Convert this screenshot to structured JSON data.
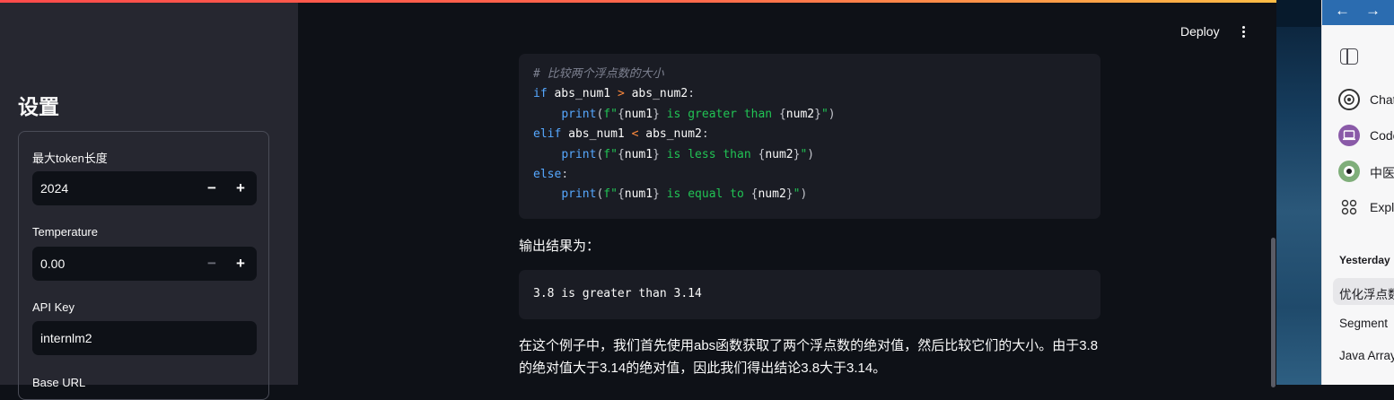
{
  "sidebar": {
    "title": "设置",
    "max_token": {
      "label": "最大token长度",
      "value": "2024",
      "minus": "−",
      "plus": "+"
    },
    "temperature": {
      "label": "Temperature",
      "value": "0.00",
      "minus": "−",
      "plus": "+"
    },
    "api_key": {
      "label": "API Key",
      "value": "internlm2"
    },
    "base_url": {
      "label": "Base URL"
    }
  },
  "header": {
    "deploy_label": "Deploy"
  },
  "chat": {
    "code_lines": [
      "# 比较两个浮点数的大小",
      "if abs_num1 > abs_num2:",
      "    print(f\"{num1} is greater than {num2}\")",
      "elif abs_num1 < abs_num2:",
      "    print(f\"{num1} is less than {num2}\")",
      "else:",
      "    print(f\"{num1} is equal to {num2}\")"
    ],
    "output_intro": "输出结果为：",
    "output_code": "3.8 is greater than 3.14",
    "explanation": "在这个例子中，我们首先使用abs函数获取了两个浮点数的绝对值，然后比较它们的大小。由于3.8的绝对值大于3.14的绝对值，因此我们得出结论3.8大于3.14。"
  },
  "right_panel": {
    "nav": {
      "back": "←",
      "forward": "→"
    },
    "items": [
      {
        "label": "Chat",
        "icon": "openai-icon"
      },
      {
        "label": "Code",
        "icon": "laptop-icon"
      },
      {
        "label": "中医",
        "icon": "eye-icon"
      },
      {
        "label": "Explo",
        "icon": "grid-icon"
      }
    ],
    "section": "Yesterday",
    "history": [
      "优化浮点数",
      "Segment",
      "Java Array"
    ]
  },
  "colors": {
    "accent_gradient_start": "#ff4b4b",
    "accent_gradient_end": "#ffbd45",
    "sidebar_bg": "#262730",
    "main_bg": "#0e1117"
  }
}
